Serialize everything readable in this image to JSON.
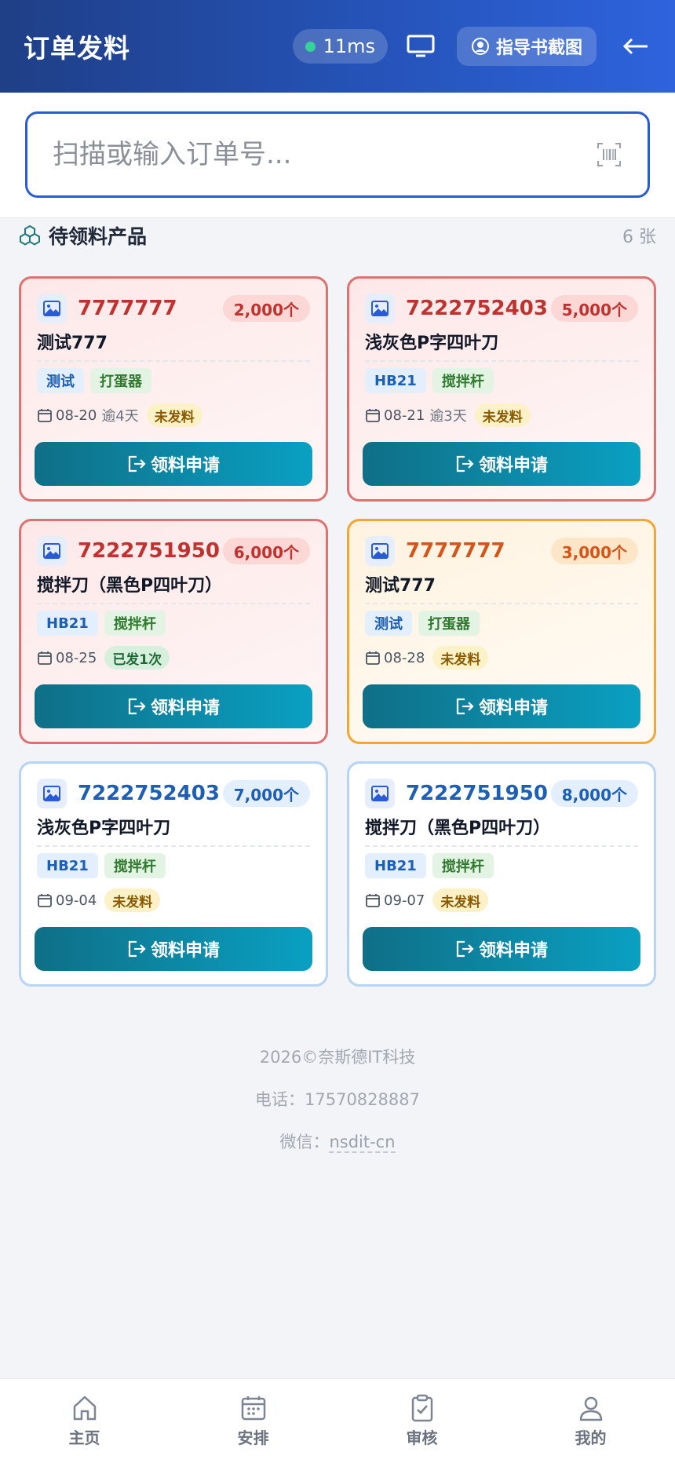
{
  "header": {
    "title": "订单发料",
    "latency": "11ms",
    "guide_label": "指导书截图"
  },
  "search": {
    "placeholder": "扫描或输入订单号..."
  },
  "section": {
    "title": "待领料产品",
    "count": "6 张"
  },
  "cards": [
    {
      "order_no": "7777777",
      "qty": "2,000个",
      "name": "测试777",
      "tag1": "测试",
      "tag2": "打蛋器",
      "date": "08-20",
      "overdue": "逾4天",
      "status": "未发料",
      "button": "领料申请"
    },
    {
      "order_no": "7222752403",
      "qty": "5,000个",
      "name": "浅灰色P字四叶刀",
      "tag1": "HB21",
      "tag2": "搅拌杆",
      "date": "08-21",
      "overdue": "逾3天",
      "status": "未发料",
      "button": "领料申请"
    },
    {
      "order_no": "7222751950",
      "qty": "6,000个",
      "name": "搅拌刀（黑色P四叶刀）",
      "tag1": "HB21",
      "tag2": "搅拌杆",
      "date": "08-25",
      "overdue": "",
      "status": "已发1次",
      "button": "领料申请"
    },
    {
      "order_no": "7777777",
      "qty": "3,000个",
      "name": "测试777",
      "tag1": "测试",
      "tag2": "打蛋器",
      "date": "08-28",
      "overdue": "",
      "status": "未发料",
      "button": "领料申请"
    },
    {
      "order_no": "7222752403",
      "qty": "7,000个",
      "name": "浅灰色P字四叶刀",
      "tag1": "HB21",
      "tag2": "搅拌杆",
      "date": "09-04",
      "overdue": "",
      "status": "未发料",
      "button": "领料申请"
    },
    {
      "order_no": "7222751950",
      "qty": "8,000个",
      "name": "搅拌刀（黑色P四叶刀）",
      "tag1": "HB21",
      "tag2": "搅拌杆",
      "date": "09-07",
      "overdue": "",
      "status": "未发料",
      "button": "领料申请"
    }
  ],
  "footer": {
    "copyright": "2026©奈斯德IT科技",
    "phone": "电话：17570828887",
    "wechat_label": "微信：",
    "wechat_value": "nsdit-cn"
  },
  "nav": [
    {
      "label": "主页",
      "icon": "home-icon"
    },
    {
      "label": "安排",
      "icon": "calendar-icon"
    },
    {
      "label": "审核",
      "icon": "clipboard-check-icon"
    },
    {
      "label": "我的",
      "icon": "user-icon"
    }
  ],
  "colors": {
    "header_start": "#1f3f86",
    "header_end": "#2e63dd",
    "overdue_border": "#e07171",
    "warning_border": "#f5a531",
    "normal_border": "#b6d4f6",
    "button_start": "#0f6f87",
    "button_end": "#0aa0c2"
  }
}
